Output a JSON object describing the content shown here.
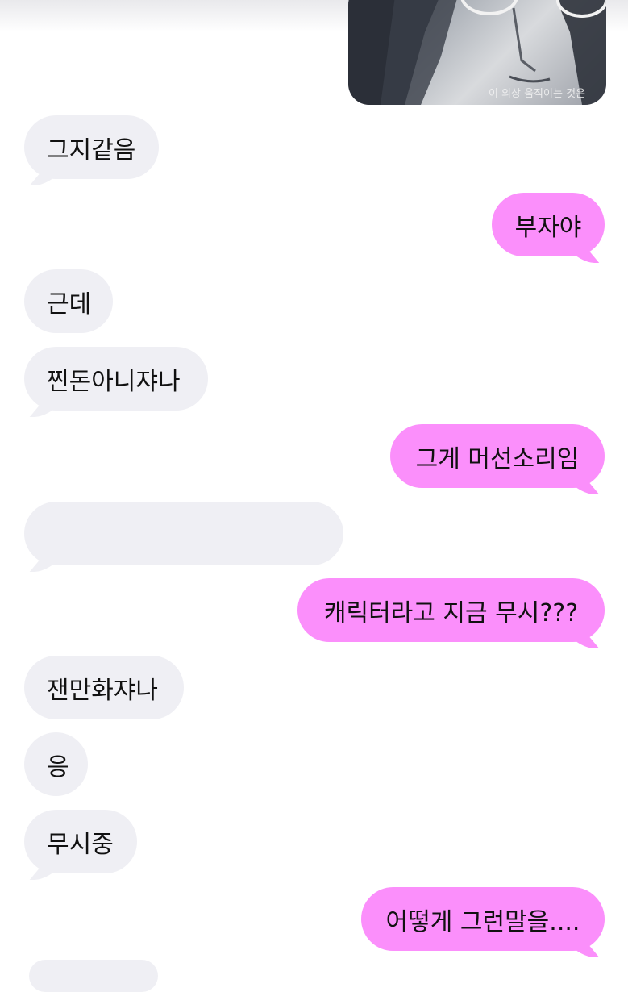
{
  "image_caption": "이 의상 움직이는 것은",
  "messages": [
    {
      "text": "그지같음",
      "from": "other"
    },
    {
      "text": "부자야",
      "from": "me"
    },
    {
      "text": "근데",
      "from": "other"
    },
    {
      "text": "찐돈아니쟈나",
      "from": "other"
    },
    {
      "text": "그게 머선소리임",
      "from": "me"
    },
    {
      "text": "",
      "from": "other"
    },
    {
      "text": "캐릭터라고 지금 무시???",
      "from": "me"
    },
    {
      "text": "잰만화쟈나",
      "from": "other"
    },
    {
      "text": "응",
      "from": "other"
    },
    {
      "text": "무시중",
      "from": "other"
    },
    {
      "text": "어떻게 그런말을....",
      "from": "me"
    }
  ],
  "colors": {
    "sent_bubble": "#fb8ffb",
    "received_bubble": "#efeff4",
    "text": "#111111"
  }
}
